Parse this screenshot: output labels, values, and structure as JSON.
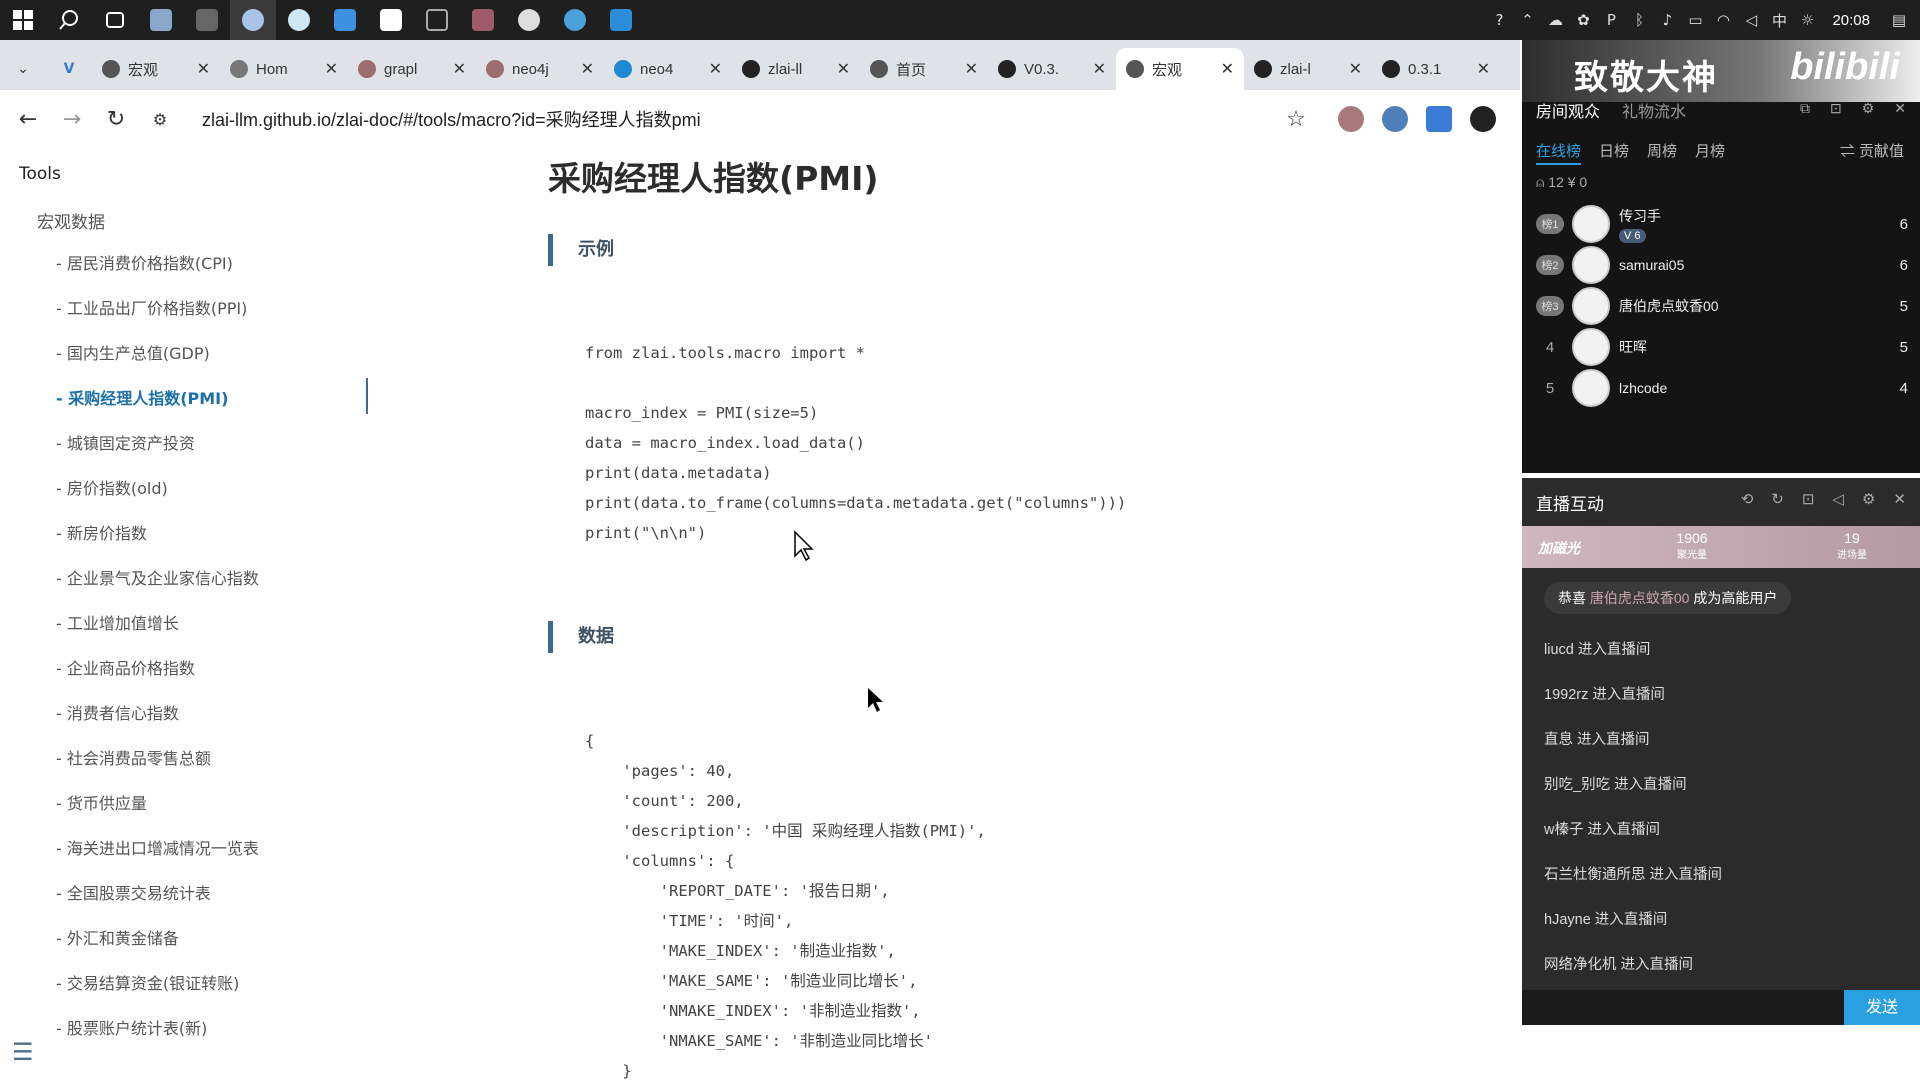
{
  "taskbar": {
    "clock": "20:08",
    "ime": "中"
  },
  "tabs": [
    {
      "title": "宏观",
      "color": "#555"
    },
    {
      "title": "Hom",
      "color": "#777"
    },
    {
      "title": "grapl",
      "color": "#9b6d6d"
    },
    {
      "title": "neo4j",
      "color": "#9b6d6d"
    },
    {
      "title": "neo4",
      "color": "#1f8ad2"
    },
    {
      "title": "zlai-ll",
      "color": "#222"
    },
    {
      "title": "首页",
      "color": "#555"
    },
    {
      "title": "V0.3.",
      "color": "#222"
    },
    {
      "title": "宏观",
      "color": "#555"
    },
    {
      "title": "zlai-l",
      "color": "#222"
    },
    {
      "title": "0.3.1",
      "color": "#222"
    }
  ],
  "address": {
    "url": "zlai-llm.github.io/zlai-doc/#/tools/macro?id=采购经理人指数pmi"
  },
  "sidebar": {
    "heading": "Tools",
    "group": "宏观数据",
    "items": [
      "- 居民消费价格指数(CPI)",
      "- 工业品出厂价格指数(PPI)",
      "- 国内生产总值(GDP)",
      "- 采购经理人指数(PMI)",
      "- 城镇固定资产投资",
      "- 房价指数(old)",
      "- 新房价指数",
      "- 企业景气及企业家信心指数",
      "- 工业增加值增长",
      "- 企业商品价格指数",
      "- 消费者信心指数",
      "- 社会消费品零售总额",
      "- 货币供应量",
      "- 海关进出口增减情况一览表",
      "- 全国股票交易统计表",
      "- 外汇和黄金储备",
      "- 交易结算资金(银证转账)",
      "- 股票账户统计表(新)"
    ],
    "active_index": 3
  },
  "content": {
    "title": "采购经理人指数(PMI)",
    "section_example": "示例",
    "code_example": "from zlai.tools.macro import *\n\nmacro_index = PMI(size=5)\ndata = macro_index.load_data()\nprint(data.metadata)\nprint(data.to_frame(columns=data.metadata.get(\"columns\")))\nprint(\"\\n\\n\")",
    "section_data": "数据",
    "code_data": "{\n    'pages': 40,\n    'count': 200,\n    'description': '中国 采购经理人指数(PMI)',\n    'columns': {\n        'REPORT_DATE': '报告日期',\n        'TIME': '时间',\n        'MAKE_INDEX': '制造业指数',\n        'MAKE_SAME': '制造业同比增长',\n        'NMAKE_INDEX': '非制造业指数',\n        'NMAKE_SAME': '非制造业同比增长'\n    }"
  },
  "overlay_top": {
    "banner_text": "致敬大神",
    "banner_brand": "bilibili",
    "tab_audience": "房间观众",
    "tab_gifts": "礼物流水",
    "subtabs": [
      "在线榜",
      "日榜",
      "周榜",
      "月榜"
    ],
    "contrib": "⇌ 贡献值",
    "stats": "⍝ 12  ¥ 0",
    "ranks": [
      {
        "rank": "榜1",
        "name": "传习手",
        "badge": "V 6",
        "score": "6"
      },
      {
        "rank": "榜2",
        "name": "samurai05",
        "badge": "",
        "score": "6"
      },
      {
        "rank": "榜3",
        "name": "唐伯虎点蚊香00",
        "badge": "",
        "score": "5"
      },
      {
        "rank": "4",
        "name": "旺晖",
        "badge": "",
        "score": "5"
      },
      {
        "rank": "5",
        "name": "lzhcode",
        "badge": "",
        "score": "4"
      }
    ]
  },
  "overlay_bottom": {
    "title": "直播互动",
    "light_label": "加磁光",
    "light_val1": "1906",
    "light_lbl1": "聚光量",
    "light_val2": "19",
    "light_lbl2": "进场量",
    "congrats_prefix": "恭喜",
    "congrats_user": "唐伯虎点蚊香00",
    "congrats_suffix": "成为高能用户",
    "entries": [
      "liucd 进入直播间",
      "1992rz 进入直播间",
      "直息 进入直播间",
      "别吃_别吃 进入直播间",
      "w榛子 进入直播间",
      "石兰杜衡通所思 进入直播间",
      "hJayne 进入直播间",
      "网络净化机 进入直播间"
    ],
    "send": "发送"
  }
}
